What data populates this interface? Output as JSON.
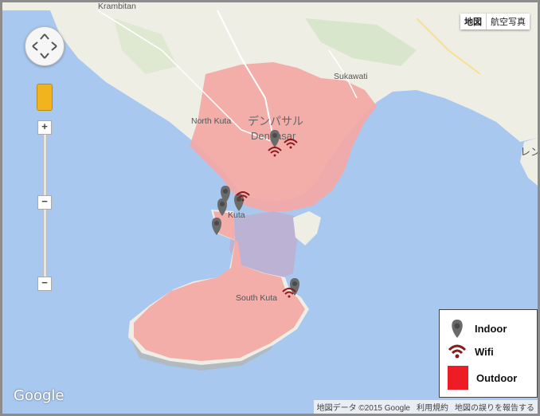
{
  "map": {
    "places": {
      "kerobokan": "Krambitan",
      "sukawati": "Sukawati",
      "north_kuta": "North Kuta",
      "denpasar_jp": "デンパサル",
      "denpasar": "Denpasar",
      "kuta": "Kuta",
      "south_kuta": "South Kuta",
      "edge_jp": "レン"
    },
    "colors": {
      "sea": "#a8c8f0",
      "land": "#efeee5",
      "coverage": "#f2aaa6",
      "marker_gray": "#6a6a6a",
      "wifi_red": "#8b1a1a",
      "outdoor_red": "#ee1c24"
    },
    "markers": [
      {
        "type": "indoor"
      },
      {
        "type": "indoor"
      },
      {
        "type": "indoor"
      },
      {
        "type": "indoor"
      },
      {
        "type": "indoor"
      },
      {
        "type": "indoor"
      },
      {
        "type": "wifi"
      },
      {
        "type": "wifi"
      },
      {
        "type": "wifi"
      },
      {
        "type": "wifi"
      }
    ]
  },
  "controls": {
    "map_btn": "地図",
    "satellite_btn": "航空写真",
    "zoom_in": "+",
    "zoom_mid": "−",
    "zoom_out": "−"
  },
  "logo": "Google",
  "attribution": {
    "data": "地図データ ©2015 Google",
    "terms": "利用規約",
    "report": "地図の誤りを報告する"
  },
  "legend": {
    "indoor": "Indoor",
    "wifi": "Wifi",
    "outdoor": "Outdoor"
  }
}
